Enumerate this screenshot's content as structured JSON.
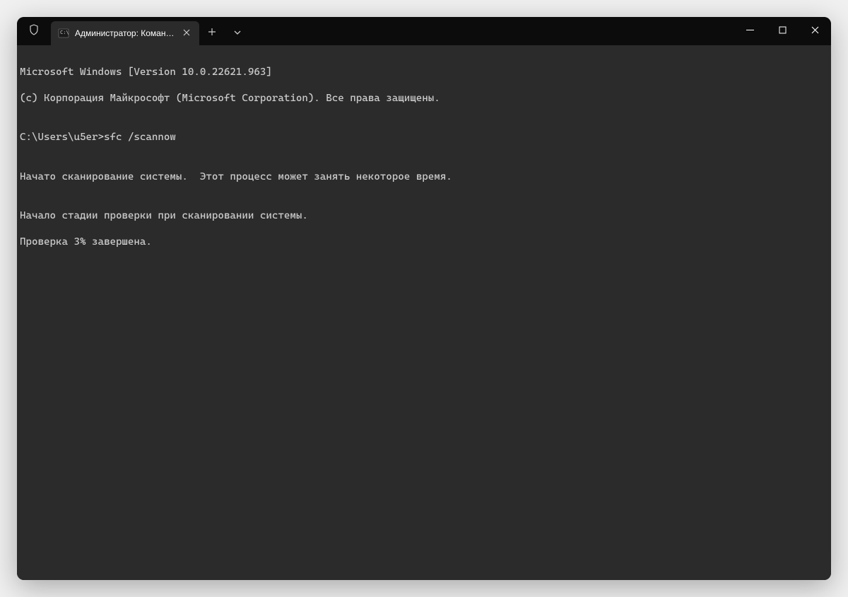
{
  "titlebar": {
    "tab": {
      "title": "Администратор: Командна"
    }
  },
  "terminal": {
    "lines": [
      "Microsoft Windows [Version 10.0.22621.963]",
      "(c) Корпорация Майкрософт (Microsoft Corporation). Все права защищены.",
      "",
      "C:\\Users\\u5er>sfc /scannow",
      "",
      "Начато сканирование системы.  Этот процесс может занять некоторое время.",
      "",
      "Начало стадии проверки при сканировании системы.",
      "Проверка 3% завершена."
    ],
    "prompt": "C:\\Users\\u5er>",
    "command": "sfc /scannow"
  }
}
